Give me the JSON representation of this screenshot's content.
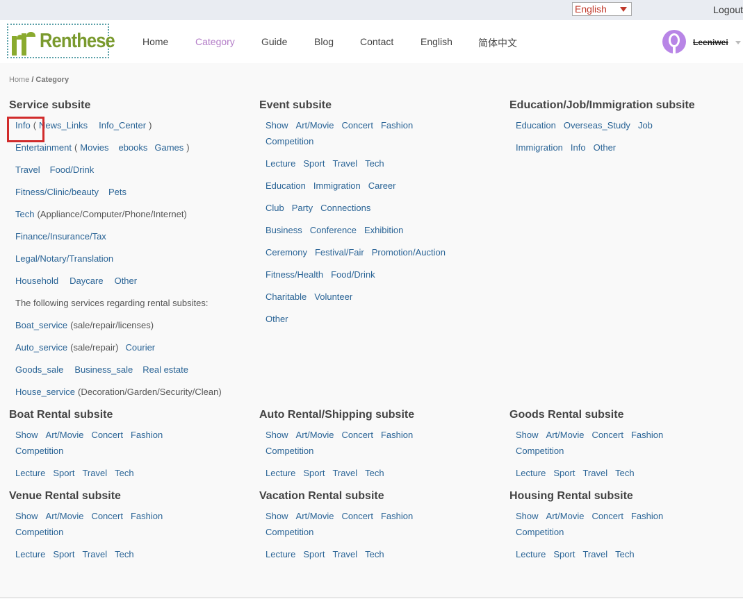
{
  "topbar": {
    "language": "English",
    "logout": "Logout"
  },
  "logo": {
    "word": "Renthese"
  },
  "nav": {
    "items": [
      "Home",
      "Category",
      "Guide",
      "Blog",
      "Contact",
      "English",
      "简体中文"
    ],
    "active_index": 1
  },
  "user": {
    "name": "Leeniwei"
  },
  "breadcrumb": {
    "home": "Home",
    "sep": "/",
    "current": "Category"
  },
  "service": {
    "title": "Service subsite",
    "info": "Info",
    "open": "(",
    "close": ")",
    "news_links": "News_Links",
    "info_center": "Info_Center",
    "entertainment": "Entertainment",
    "movies": "Movies",
    "ebooks": "ebooks",
    "games": "Games",
    "travel": "Travel",
    "food_drink": "Food/Drink",
    "fitness": "Fitness/Clinic/beauty",
    "pets": "Pets",
    "tech": "Tech",
    "tech_note": "(Appliance/Computer/Phone/Internet)",
    "finance": "Finance/Insurance/Tax",
    "legal": "Legal/Notary/Translation",
    "household": "Household",
    "daycare": "Daycare",
    "other": "Other",
    "rental_note": "The following services regarding rental subsites:",
    "boat": "Boat_service",
    "boat_note": "(sale/repair/licenses)",
    "auto": "Auto_service",
    "auto_note": "(sale/repair)",
    "courier": "Courier",
    "goods_sale": "Goods_sale",
    "business_sale": "Business_sale",
    "real_estate": "Real estate",
    "house": "House_service",
    "house_note": "(Decoration/Garden/Security/Clean)"
  },
  "event": {
    "title": "Event subsite",
    "rows": [
      [
        "Show",
        "Art/Movie",
        "Concert",
        "Fashion"
      ],
      [
        "Competition"
      ],
      [
        "Lecture",
        "Sport",
        "Travel",
        "Tech"
      ],
      [
        "Education",
        "Immigration",
        "Career"
      ],
      [
        "Club",
        "Party",
        "Connections"
      ],
      [
        "Business",
        "Conference",
        "Exhibition"
      ],
      [
        "Ceremony",
        "Festival/Fair",
        "Promotion/Auction"
      ],
      [
        "Fitness/Health",
        "Food/Drink"
      ],
      [
        "Charitable",
        "Volunteer"
      ],
      [
        "Other"
      ]
    ]
  },
  "education": {
    "title": "Education/Job/Immigration subsite",
    "rows": [
      [
        "Education",
        "Overseas_Study",
        "Job"
      ],
      [
        "Immigration",
        "Info",
        "Other"
      ]
    ]
  },
  "rentals": [
    {
      "title": "Boat Rental subsite",
      "rows": [
        [
          "Show",
          "Art/Movie",
          "Concert",
          "Fashion"
        ],
        [
          "Competition"
        ],
        [
          "Lecture",
          "Sport",
          "Travel",
          "Tech"
        ]
      ]
    },
    {
      "title": "Auto Rental/Shipping subsite",
      "rows": [
        [
          "Show",
          "Art/Movie",
          "Concert",
          "Fashion"
        ],
        [
          "Competition"
        ],
        [
          "Lecture",
          "Sport",
          "Travel",
          "Tech"
        ]
      ]
    },
    {
      "title": "Goods Rental subsite",
      "rows": [
        [
          "Show",
          "Art/Movie",
          "Concert",
          "Fashion"
        ],
        [
          "Competition"
        ],
        [
          "Lecture",
          "Sport",
          "Travel",
          "Tech"
        ]
      ]
    },
    {
      "title": "Venue Rental subsite",
      "rows": [
        [
          "Show",
          "Art/Movie",
          "Concert",
          "Fashion"
        ],
        [
          "Competition"
        ],
        [
          "Lecture",
          "Sport",
          "Travel",
          "Tech"
        ]
      ]
    },
    {
      "title": "Vacation Rental subsite",
      "rows": [
        [
          "Show",
          "Art/Movie",
          "Concert",
          "Fashion"
        ],
        [
          "Competition"
        ],
        [
          "Lecture",
          "Sport",
          "Travel",
          "Tech"
        ]
      ]
    },
    {
      "title": "Housing Rental subsite",
      "rows": [
        [
          "Show",
          "Art/Movie",
          "Concert",
          "Fashion"
        ],
        [
          "Competition"
        ],
        [
          "Lecture",
          "Sport",
          "Travel",
          "Tech"
        ]
      ]
    }
  ],
  "colors": {
    "link": "#2a6496",
    "active_nav": "#b47ec8",
    "highlight": "#d12b2b",
    "logo_green": "#7a9a2e"
  }
}
